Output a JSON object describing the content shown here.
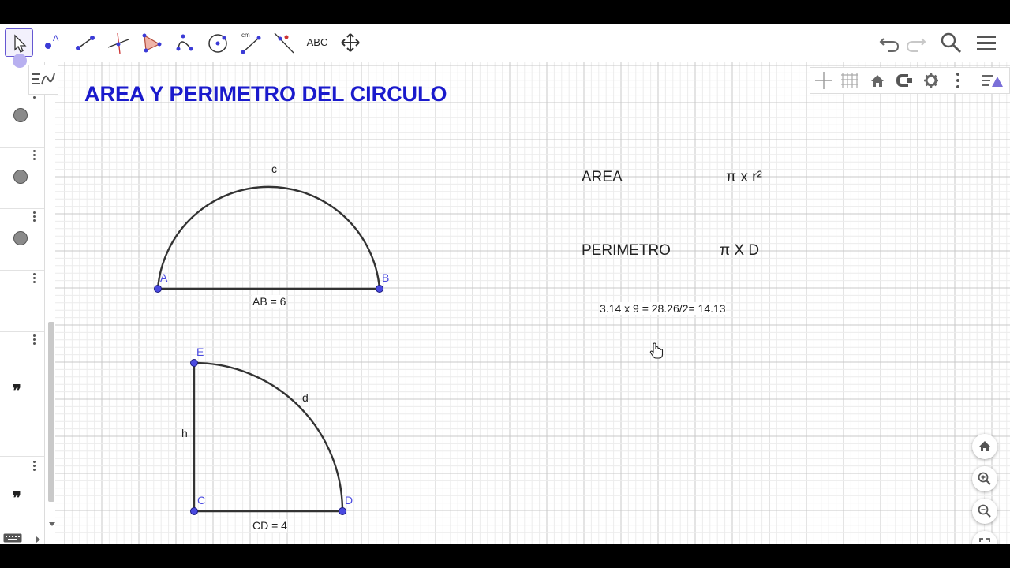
{
  "toolbar": {
    "tools": [
      "move",
      "point",
      "line",
      "perpendicular-line",
      "polygon",
      "circle-arc",
      "circle",
      "distance",
      "slope",
      "text",
      "move-graphics-view"
    ],
    "tool_cm_label": "cm",
    "tool_text_label": "ABC",
    "selected_tool": "move"
  },
  "header_icons": [
    "undo-icon",
    "redo-icon",
    "search-icon",
    "menu-icon"
  ],
  "algebra": {
    "row_icons": [
      "point-dot",
      "point-dot",
      "point-dot",
      "empty",
      "quote",
      "quote"
    ],
    "quote_glyph": "❞"
  },
  "graphics": {
    "title": "AREA Y PERIMETRO DEL CIRCULO",
    "semicircle": {
      "arc_label": "c",
      "point_a": "A",
      "point_b": "B",
      "segment_label": "AB = 6"
    },
    "quarter": {
      "arc_label": "d",
      "point_e": "E",
      "point_c": "C",
      "point_d": "D",
      "side_label": "h",
      "segment_label": "CD = 4"
    },
    "formulas": {
      "area_label": "AREA",
      "area_formula": "π x r²",
      "perimeter_label": "PERIMETRO",
      "perimeter_formula": "π X D",
      "calculation": "3.14 x 9 = 28.26/2= 14.13"
    }
  },
  "style_bar_icons": [
    "axes-icon",
    "grid-icon",
    "home-icon",
    "point-capture-icon",
    "settings-icon",
    "more-icon"
  ],
  "zoom_controls": [
    "home-icon",
    "zoom-in-icon",
    "zoom-out-icon",
    "fullscreen-icon"
  ],
  "colors": {
    "title": "#1a1acc",
    "point": "#4a4ae0",
    "point_label": "#4a4ae0",
    "selected_tool_border": "#6557d2",
    "grid_major": "#c8c8c8",
    "grid_minor": "#ececec"
  }
}
